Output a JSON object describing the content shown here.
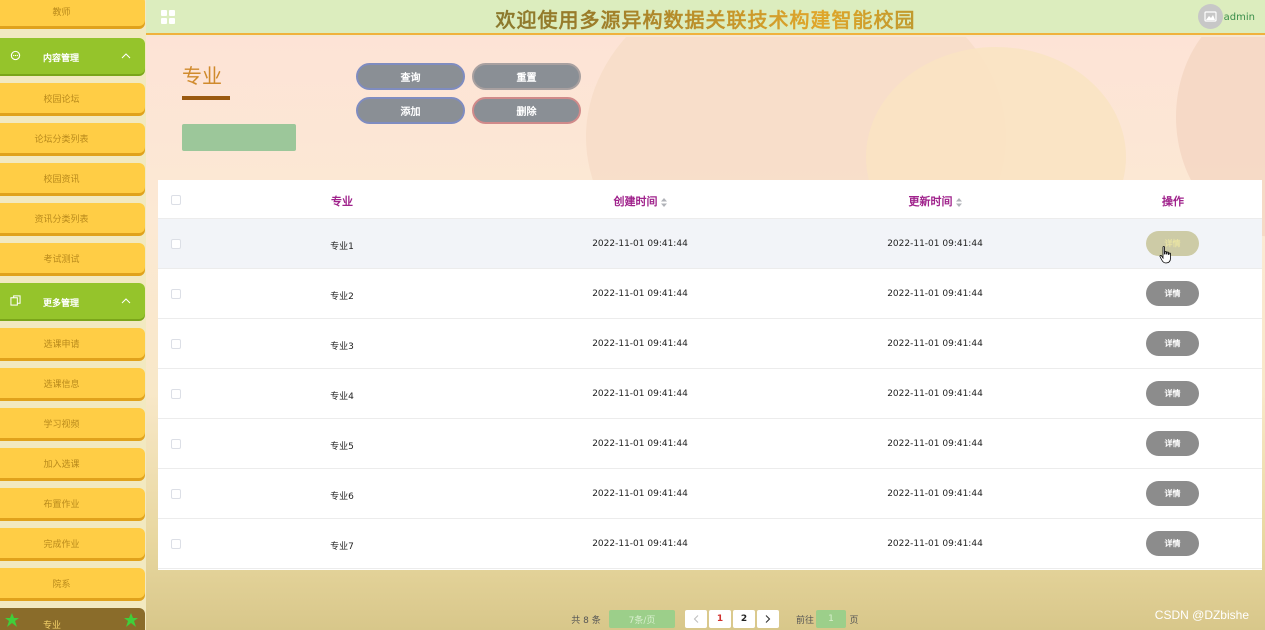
{
  "app": {
    "title": "欢迎使用多源异构数据关联技术构建智能校园",
    "user": "admin"
  },
  "sidebar": {
    "top_item": "教师",
    "groups": [
      {
        "label": "内容管理",
        "icon": "chat-bubble-icon",
        "items": [
          "校园论坛",
          "论坛分类列表",
          "校园资讯",
          "资讯分类列表",
          "考试测试"
        ]
      },
      {
        "label": "更多管理",
        "icon": "copy-icon",
        "items": [
          "选课申请",
          "选课信息",
          "学习视频",
          "加入选课",
          "布置作业",
          "完成作业",
          "院系"
        ]
      }
    ],
    "active_item": "专业"
  },
  "page": {
    "title": "专业"
  },
  "toolbar": {
    "query": "查询",
    "reset": "重置",
    "add": "添加",
    "delete": "删除"
  },
  "table": {
    "headers": {
      "major": "专业",
      "created": "创建时间",
      "updated": "更新时间",
      "operation": "操作"
    },
    "detail_label": "详情",
    "rows": [
      {
        "major": "专业1",
        "created": "2022-11-01 09:41:44",
        "updated": "2022-11-01 09:41:44"
      },
      {
        "major": "专业2",
        "created": "2022-11-01 09:41:44",
        "updated": "2022-11-01 09:41:44"
      },
      {
        "major": "专业3",
        "created": "2022-11-01 09:41:44",
        "updated": "2022-11-01 09:41:44"
      },
      {
        "major": "专业4",
        "created": "2022-11-01 09:41:44",
        "updated": "2022-11-01 09:41:44"
      },
      {
        "major": "专业5",
        "created": "2022-11-01 09:41:44",
        "updated": "2022-11-01 09:41:44"
      },
      {
        "major": "专业6",
        "created": "2022-11-01 09:41:44",
        "updated": "2022-11-01 09:41:44"
      },
      {
        "major": "专业7",
        "created": "2022-11-01 09:41:44",
        "updated": "2022-11-01 09:41:44"
      }
    ]
  },
  "pagination": {
    "total": "共 8 条",
    "page_size": "7条/页",
    "pages": [
      "1",
      "2"
    ],
    "current": "1",
    "goto_label": "前往",
    "goto_value": "1",
    "suffix": "页"
  },
  "watermark": "CSDN @DZbishe",
  "colors": {
    "accent_green": "#95c42b",
    "menu_yellow": "#ffcd45",
    "header_purple": "#a0238c",
    "title_orange": "#d08a2c"
  }
}
